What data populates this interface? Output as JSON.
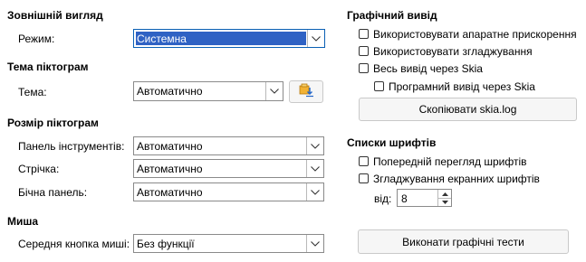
{
  "appearance": {
    "heading": "Зовнішній вигляд",
    "mode_label": "Режим:",
    "mode_value": "Системна"
  },
  "icon_theme": {
    "heading": "Тема піктограм",
    "theme_label": "Тема:",
    "theme_value": "Автоматично"
  },
  "icon_size": {
    "heading": "Розмір піктограм",
    "toolbar_label": "Панель інструментів:",
    "toolbar_value": "Автоматично",
    "ribbon_label": "Стрічка:",
    "ribbon_value": "Автоматично",
    "sidebar_label": "Бічна панель:",
    "sidebar_value": "Автоматично"
  },
  "mouse": {
    "heading": "Миша",
    "middle_button_label": "Середня кнопка миші:",
    "middle_button_value": "Без функції"
  },
  "graphics_output": {
    "heading": "Графічний вивід",
    "hardware_accel": "Використовувати апаратне прискорення",
    "antialiasing": "Використовувати згладжування",
    "skia_all": "Весь вивід через Skia",
    "skia_software": "Програмний вивід через Skia",
    "copy_log_button": "Скопіювати skia.log"
  },
  "font_lists": {
    "heading": "Списки шрифтів",
    "preview_fonts": "Попередній перегляд шрифтів",
    "screen_font_aa": "Згладжування екранних шрифтів",
    "from_label": "від:",
    "from_value": "8"
  },
  "run_tests_button": "Виконати графічні тести",
  "colors": {
    "selection": "#2f62c4",
    "border": "#8a8a8a"
  }
}
